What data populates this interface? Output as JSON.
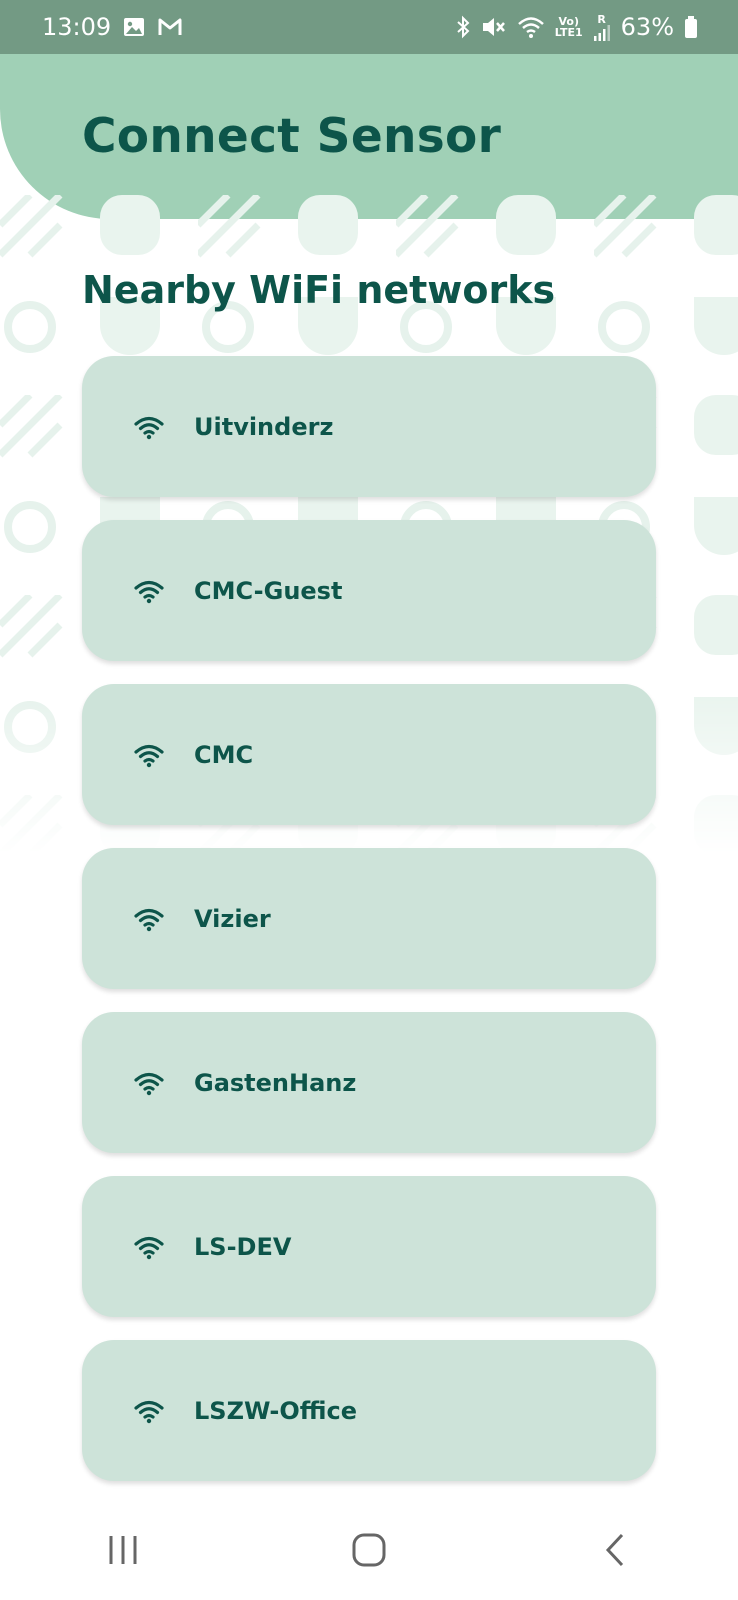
{
  "status_bar": {
    "time": "13:09",
    "net_top": "Vo)",
    "net_bottom": "LTE1",
    "roaming": "R",
    "battery": "63%",
    "icons": [
      "gallery-icon",
      "gmail-icon",
      "bluetooth-icon",
      "mute-icon",
      "wifi-icon",
      "signal-icon",
      "battery-icon"
    ]
  },
  "header": {
    "title": "Connect Sensor"
  },
  "section": {
    "title": "Nearby WiFi networks"
  },
  "networks": [
    {
      "name": "Uitvinderz"
    },
    {
      "name": "CMC-Guest"
    },
    {
      "name": "CMC"
    },
    {
      "name": "Vizier"
    },
    {
      "name": "GastenHanz"
    },
    {
      "name": "LS-DEV"
    },
    {
      "name": "LSZW-Office"
    }
  ],
  "nav_bar": {
    "buttons": [
      "recent-apps",
      "home",
      "back"
    ]
  },
  "colors": {
    "status_bar": "#739a84",
    "header": "#a0d0b6",
    "card": "#cde3d9",
    "text": "#0d554a",
    "pattern": "#e9f4ee"
  }
}
